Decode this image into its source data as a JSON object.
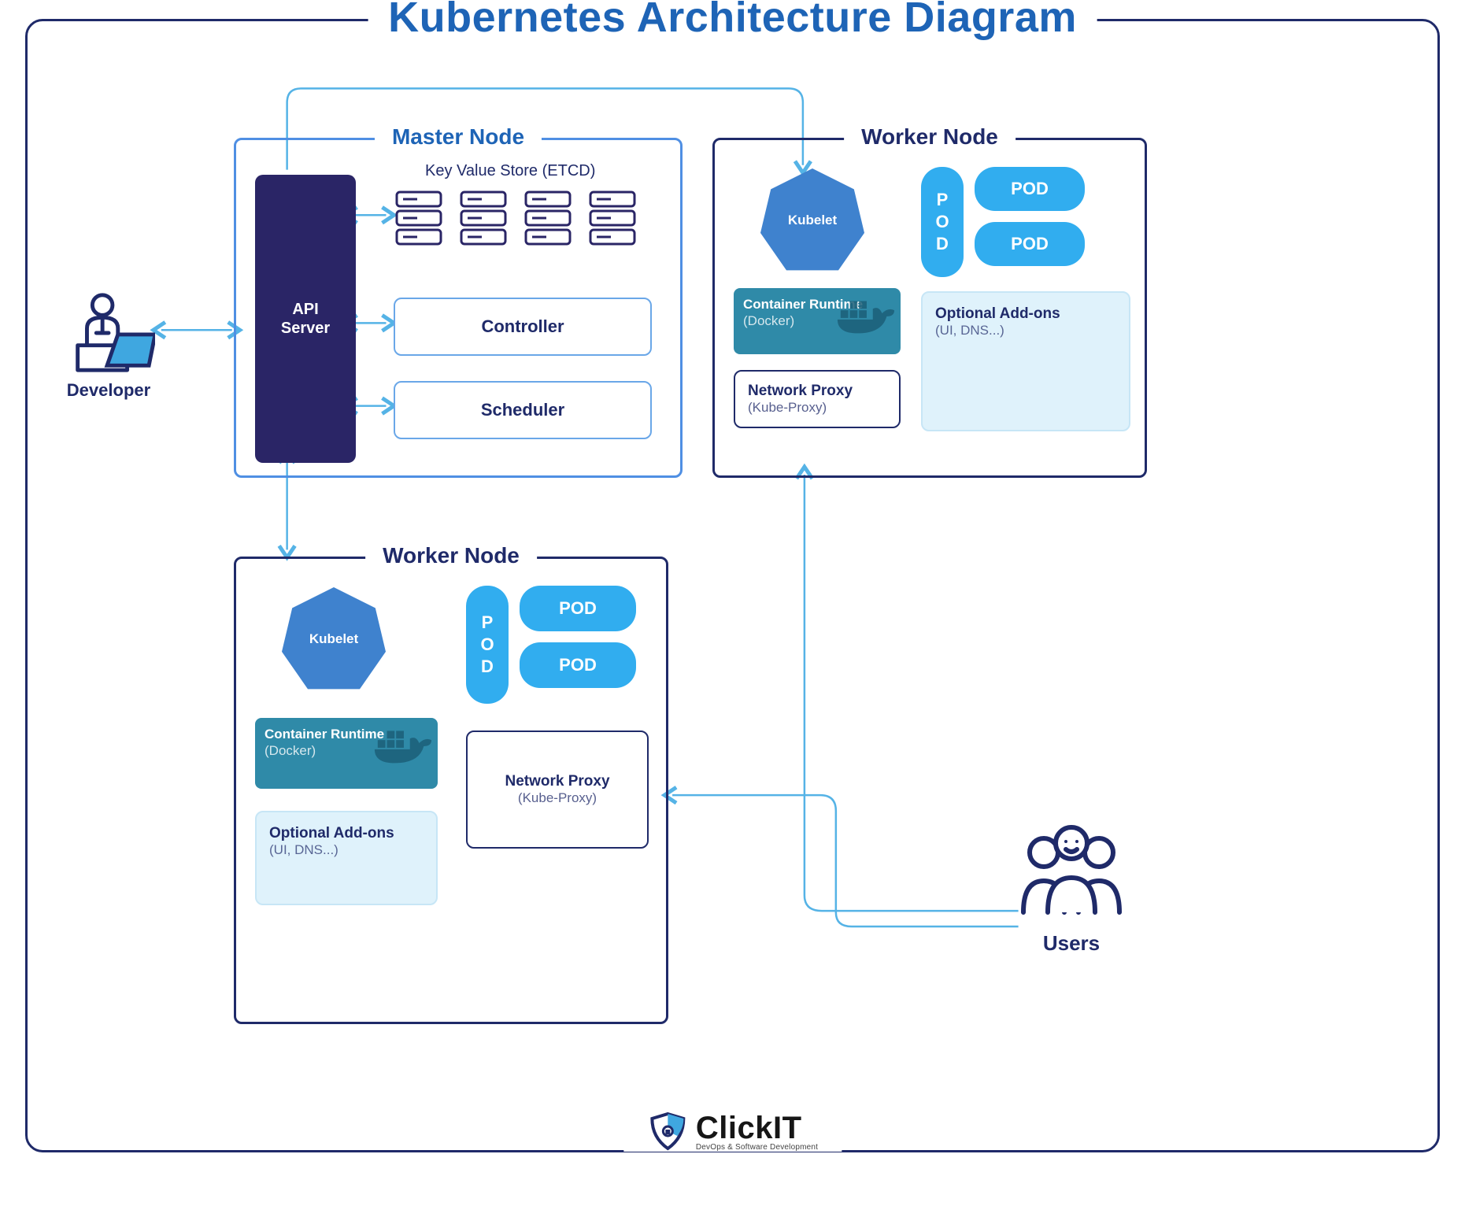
{
  "title": "Kubernetes Architecture Diagram",
  "actors": {
    "developer": "Developer",
    "users": "Users"
  },
  "master": {
    "title": "Master Node",
    "api": "API\nServer",
    "etcdLabel": "Key Value Store (ETCD)",
    "controller": "Controller",
    "scheduler": "Scheduler"
  },
  "worker": {
    "title": "Worker Node",
    "kubelet": "Kubelet",
    "containerRuntime": {
      "title": "Container Runtime",
      "subtitle": "(Docker)"
    },
    "networkProxy": {
      "title": "Network Proxy",
      "subtitle": "(Kube-Proxy)"
    },
    "addons": {
      "title": "Optional Add-ons",
      "subtitle": "(UI, DNS...)"
    },
    "pod": "POD",
    "podLetters": [
      "P",
      "O",
      "D"
    ]
  },
  "brand": {
    "name": "ClickIT",
    "tagline": "DevOps & Software Development"
  },
  "colors": {
    "navy": "#1f2a69",
    "blue": "#1e64b6",
    "lightblue": "#55b3e6",
    "sky": "#31adef",
    "apiFill": "#2a2566",
    "heptFill": "#3f82ce",
    "teal": "#2f8aa8",
    "pale": "#dff2fb"
  },
  "diagram": {
    "nodes": [
      "Developer",
      "Master Node",
      "Worker Node (top-right)",
      "Worker Node (bottom)",
      "Users"
    ],
    "masterComponents": [
      "API Server",
      "Key Value Store (ETCD)",
      "Controller",
      "Scheduler"
    ],
    "workerComponents": [
      "Kubelet",
      "Container Runtime (Docker)",
      "Network Proxy (Kube-Proxy)",
      "POD",
      "Optional Add-ons (UI, DNS...)"
    ],
    "edges": [
      [
        "Developer",
        "API Server",
        "bidirectional"
      ],
      [
        "API Server",
        "Key Value Store (ETCD)",
        "bidirectional"
      ],
      [
        "API Server",
        "Controller",
        "bidirectional"
      ],
      [
        "API Server",
        "Scheduler",
        "bidirectional"
      ],
      [
        "API Server",
        "Worker Node (top-right)",
        "down-into"
      ],
      [
        "API Server",
        "Worker Node (bottom)",
        "bidirectional"
      ],
      [
        "Users",
        "Worker Node (top-right) Network Proxy",
        "to"
      ],
      [
        "Users",
        "Worker Node (bottom) Network Proxy",
        "to"
      ]
    ]
  }
}
